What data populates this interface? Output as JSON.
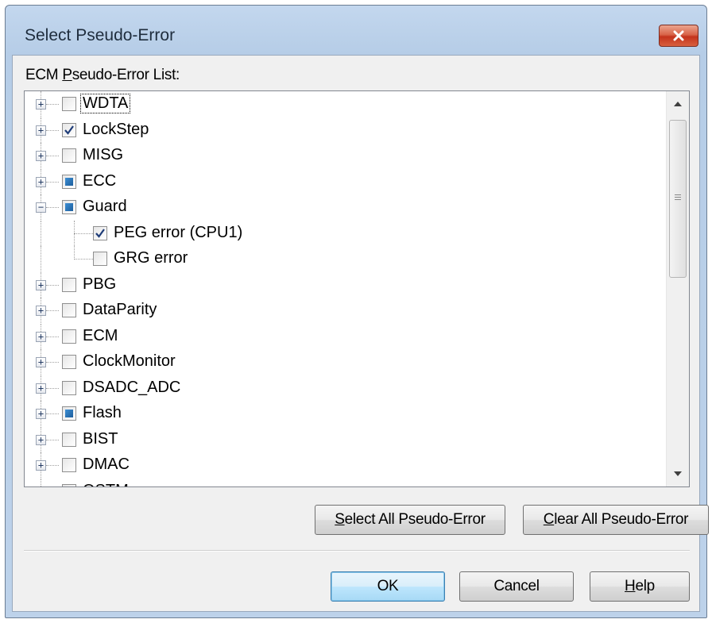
{
  "window": {
    "title": "Select Pseudo-Error",
    "close_icon": "close-icon"
  },
  "list": {
    "label_accel": "P",
    "label_pre": "ECM ",
    "label_post": "seudo-Error List:"
  },
  "tree": [
    {
      "label": "WDTA",
      "expander": "+",
      "state": "unchecked",
      "focused": true
    },
    {
      "label": "LockStep",
      "expander": "+",
      "state": "checked"
    },
    {
      "label": "MISG",
      "expander": "+",
      "state": "unchecked"
    },
    {
      "label": "ECC",
      "expander": "+",
      "state": "partial"
    },
    {
      "label": "Guard",
      "expander": "−",
      "state": "partial"
    },
    {
      "label": "PEG error (CPU1)",
      "state": "checked",
      "child": true
    },
    {
      "label": "GRG error",
      "state": "unchecked",
      "child": true
    },
    {
      "label": "PBG",
      "expander": "+",
      "state": "unchecked"
    },
    {
      "label": "DataParity",
      "expander": "+",
      "state": "unchecked"
    },
    {
      "label": "ECM",
      "expander": "+",
      "state": "unchecked"
    },
    {
      "label": "ClockMonitor",
      "expander": "+",
      "state": "unchecked"
    },
    {
      "label": "DSADC_ADC",
      "expander": "+",
      "state": "unchecked"
    },
    {
      "label": "Flash",
      "expander": "+",
      "state": "partial"
    },
    {
      "label": "BIST",
      "expander": "+",
      "state": "unchecked"
    },
    {
      "label": "DMAC",
      "expander": "+",
      "state": "unchecked"
    },
    {
      "label": "OSTM",
      "expander": "+",
      "state": "unchecked"
    }
  ],
  "buttons": {
    "select_all_accel": "S",
    "select_all_rest": "elect All Pseudo-Error",
    "clear_all_accel": "C",
    "clear_all_rest": "lear All Pseudo-Error",
    "ok": "OK",
    "cancel": "Cancel",
    "help_accel": "H",
    "help_rest": "elp"
  },
  "colors": {
    "partial_fill": "#1d5e9c",
    "default_button_border": "#3c7fb1",
    "close_button": "#c4331c"
  }
}
